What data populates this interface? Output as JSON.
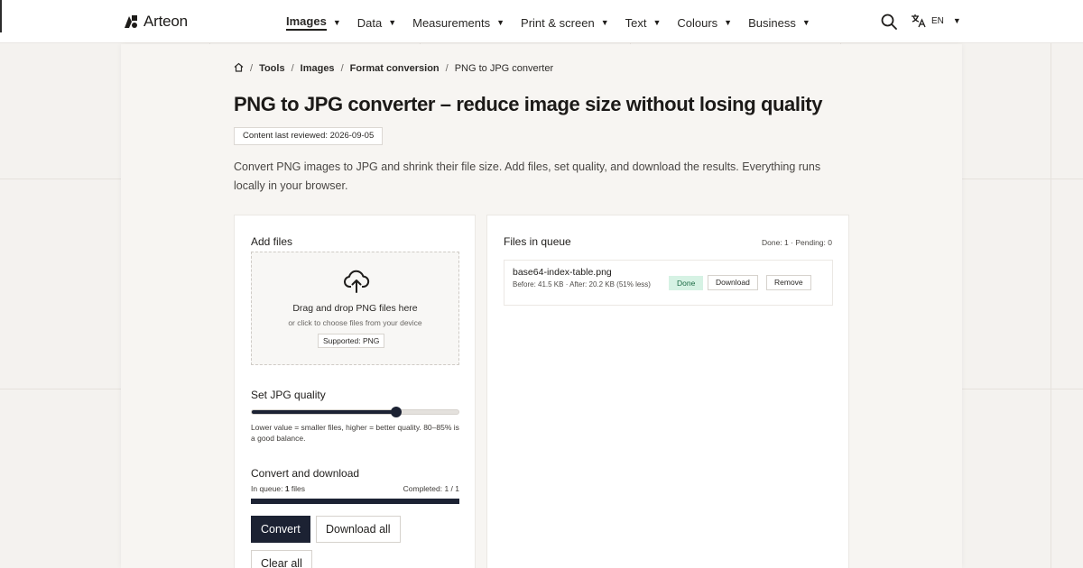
{
  "header": {
    "brand": "Arteon",
    "nav": [
      {
        "label": "Images",
        "active": true
      },
      {
        "label": "Data",
        "active": false
      },
      {
        "label": "Measurements",
        "active": false
      },
      {
        "label": "Print & screen",
        "active": false
      },
      {
        "label": "Text",
        "active": false
      },
      {
        "label": "Colours",
        "active": false
      },
      {
        "label": "Business",
        "active": false
      }
    ],
    "language": "EN"
  },
  "breadcrumb": [
    "Tools",
    "Images",
    "Format conversion",
    "PNG to JPG converter"
  ],
  "page": {
    "title": "PNG to JPG converter – reduce image size without losing quality",
    "reviewed": "Content last reviewed: 2026-09-05",
    "intro": "Convert PNG images to JPG and shrink their file size. Add files, set quality, and download the results. Everything runs locally in your browser."
  },
  "add_files": {
    "title": "Add files",
    "drop_main": "Drag and drop PNG files here",
    "drop_sub": "or click to choose files from your device",
    "supported": "Supported: PNG"
  },
  "quality": {
    "title": "Set JPG quality",
    "value": 0.7,
    "hint": "Lower value = smaller files, higher = better quality. 80–85% is a good balance."
  },
  "convert": {
    "title": "Convert and download",
    "queue_prefix": "In queue: ",
    "queue_count": "1",
    "queue_suffix": " files",
    "completed": "Completed: 1 / 1",
    "progress": 1.0,
    "convert_label": "Convert",
    "download_all_label": "Download all",
    "clear_all_label": "Clear all"
  },
  "queue": {
    "title": "Files in queue",
    "counts": "Done: 1 · Pending: 0",
    "items": [
      {
        "name": "base64-index-table.png",
        "sizes": "Before: 41.5 KB · After: 20.2 KB (51% less)",
        "status": "Done",
        "download_label": "Download",
        "remove_label": "Remove"
      }
    ]
  },
  "colors": {
    "accent": "#1c2233",
    "done_badge_bg": "#d6f2e4",
    "done_badge_text": "#1d6b45",
    "page_bg": "#f4f2ef"
  }
}
